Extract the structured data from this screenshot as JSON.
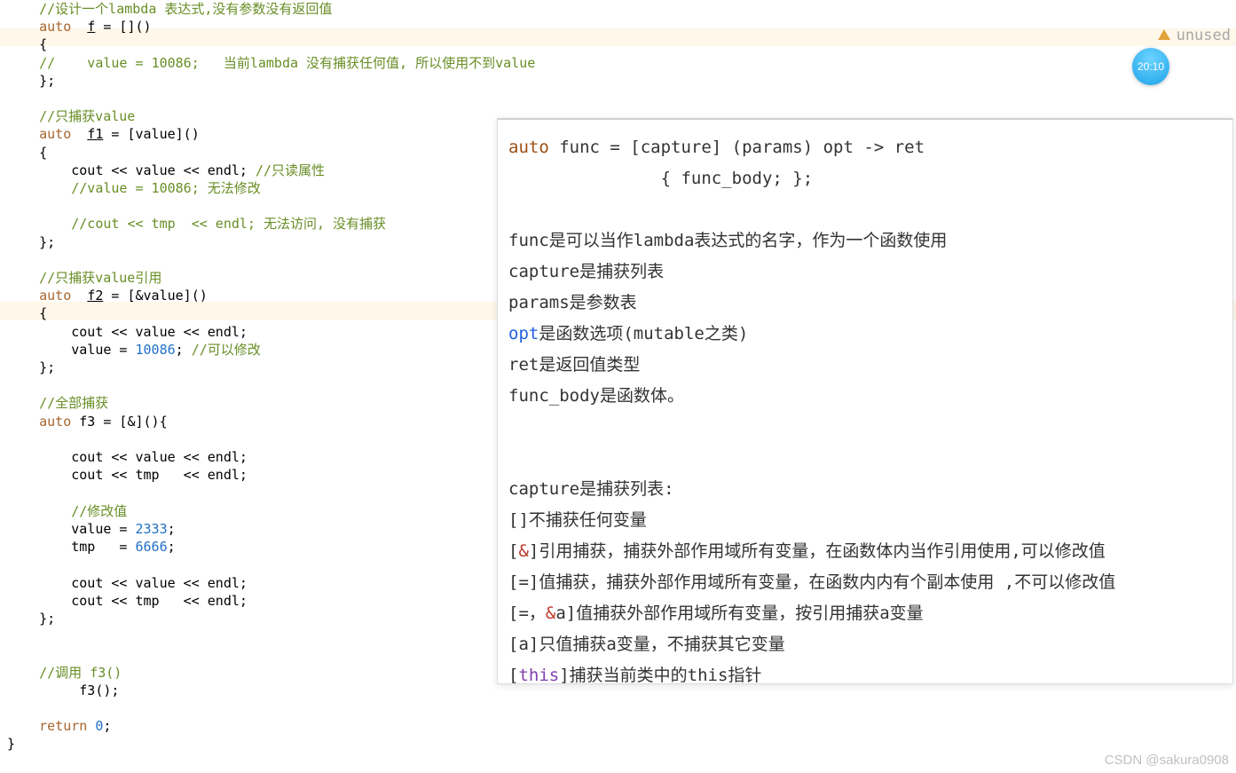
{
  "warning": {
    "label": "unused"
  },
  "clock": {
    "time": "20:10"
  },
  "code": {
    "indent": "    ",
    "c1": "//设计一个lambda 表达式,没有参数没有返回值",
    "l2a": "auto",
    "l2b": "  ",
    "l2c": "f",
    "l2d": " = []()",
    "l3": "{",
    "c4a": "//",
    "l4b": "    value = ",
    "l4c": "10086",
    "l4d": ";   ",
    "c4e": "当前lambda 没有捕获任何值, 所以使用不到value",
    "l5": "};",
    "c7": "//只捕获value",
    "l8a": "auto",
    "l8b": "  ",
    "l8c": "f1",
    "l8d": " = [value]()",
    "l9": "{",
    "l10a": "    cout << value << endl; ",
    "c10b": "//只读属性",
    "c11": "    //value = 10086; 无法修改",
    "c13": "    //cout << tmp  << endl; 无法访问, 没有捕获",
    "l14": "};",
    "c16": "//只捕获value引用",
    "l17a": "auto",
    "l17b": "  ",
    "l17c": "f2",
    "l17d": " = [&value]()",
    "l18": "{",
    "l19": "    cout << value << endl;",
    "l20a": "    value = ",
    "l20b": "10086",
    "l20c": "; ",
    "c20d": "//可以修改",
    "l21": "};",
    "c23": "//全部捕获",
    "l24a": "auto",
    "l24b": " f3 = [&](){",
    "l26": "    cout << value << endl;",
    "l27": "    cout << tmp   << endl;",
    "c29": "    //修改值",
    "l30a": "    value = ",
    "l30b": "2333",
    "l30c": ";",
    "l31a": "    tmp   = ",
    "l31b": "6666",
    "l31c": ";",
    "l33": "    cout << value << endl;",
    "l34": "    cout << tmp   << endl;",
    "l35": "};",
    "c38": "//调用 f3()",
    "l39": "     f3();",
    "l41a": "return",
    "l41b": " ",
    "l41c": "0",
    "l41d": ";",
    "l42": "}"
  },
  "info": {
    "syn1a": "auto",
    "syn1b": " func = [capture] (params) opt -> ret",
    "syn2": "               { func_body; };",
    "desc_func": "func是可以当作lambda表达式的名字，作为一个函数使用",
    "desc_cap": "capture是捕获列表",
    "desc_params": "params是参数表",
    "desc_opt_a": "opt",
    "desc_opt_b": "是函数选项(mutable之类)",
    "desc_ret": "ret是返回值类型",
    "desc_body": "func_body是函数体。",
    "cap_hdr": "capture是捕获列表:",
    "cap1": "[]不捕获任何变量",
    "cap2a": "[",
    "cap2b": "&",
    "cap2c": "]引用捕获，捕获外部作用域所有变量，在函数体内当作引用使用,可以修改值",
    "cap3": "[=]值捕获，捕获外部作用域所有变量，在函数内内有个副本使用  ,不可以修改值",
    "cap4a": "[=，",
    "cap4amp": "&",
    "cap4b": "a]值捕获外部作用域所有变量，按引用捕获a变量",
    "cap5": "[a]只值捕获a变量，不捕获其它变量",
    "cap6a": "[",
    "cap6b": "this",
    "cap6c": "]捕获当前类中的this指针"
  },
  "watermark": "CSDN @sakura0908"
}
